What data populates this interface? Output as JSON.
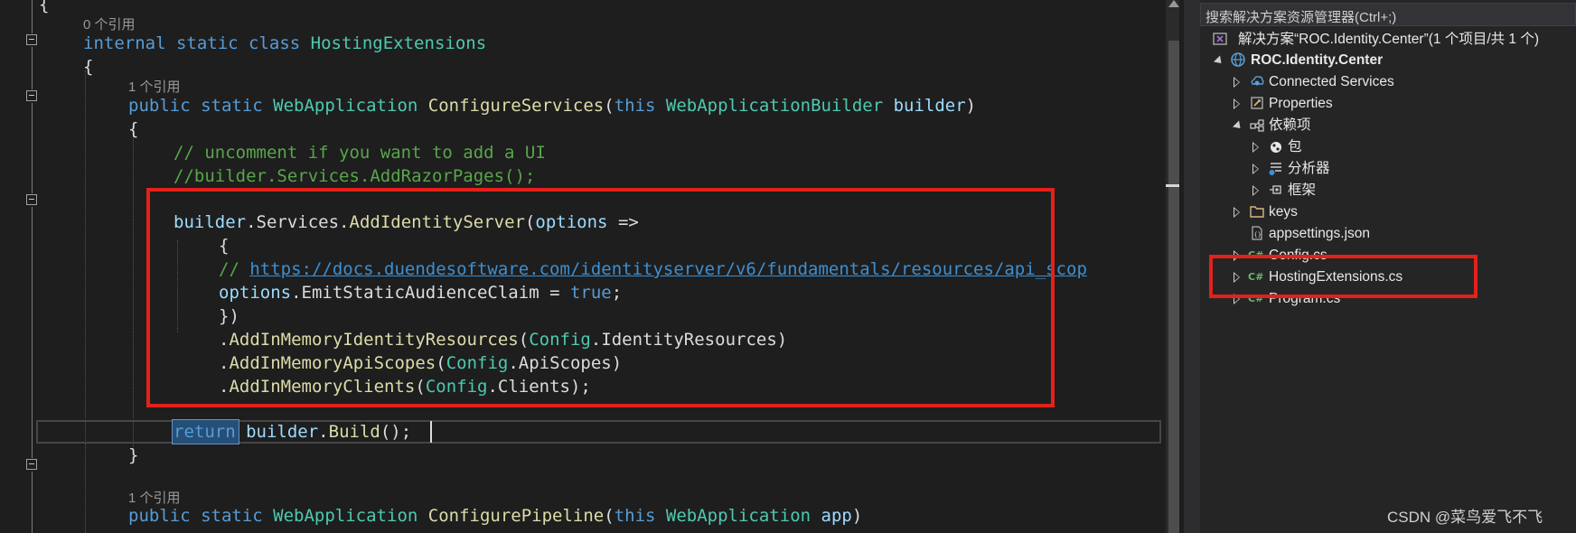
{
  "editor": {
    "codelens": {
      "class_refs": "0 个引用",
      "configure_services_refs": "1 个引用",
      "configure_pipeline_refs": "1 个引用"
    },
    "lines": {
      "open_brace_top": "{",
      "class_modifiers": "internal static class",
      "class_name": "HostingExtensions",
      "class_open": "{",
      "method_modifiers": "public static",
      "method_return_type": "WebApplication",
      "method_name": "ConfigureServices",
      "method_paren_open": "(",
      "this_kw": "this",
      "param_type": "WebApplicationBuilder",
      "param_name": "builder",
      "method_paren_close": ")",
      "method_open": "{",
      "comment_1": "// uncomment if you want to add a UI",
      "comment_2": "//builder.Services.AddRazorPages();",
      "add_is_var": "builder",
      "add_is_dot1": ".",
      "add_is_services": "Services",
      "add_is_dot2": ".",
      "add_is_method": "AddIdentityServer",
      "add_is_paren": "(",
      "add_is_options": "options",
      "add_is_arrow": " =>",
      "lambda_open": "{",
      "url_comment_prefix": "// ",
      "url": "https://docs.duendesoftware.com/identityserver/v6/fundamentals/resources/api_scop",
      "emit_options": "options",
      "emit_dot": ".",
      "emit_prop": "EmitStaticAudienceClaim",
      "emit_eq": " = ",
      "emit_true": "true",
      "emit_semi": ";",
      "lambda_close": "})",
      "identity_dot": ".",
      "identity_method": "AddInMemoryIdentityResources",
      "identity_paren": "(",
      "identity_config": "Config",
      "identity_dot2": ".",
      "identity_prop": "IdentityResources",
      "identity_close": ")",
      "api_dot": ".",
      "api_method": "AddInMemoryApiScopes",
      "api_paren": "(",
      "api_config": "Config",
      "api_dot2": ".",
      "api_prop": "ApiScopes",
      "api_close": ")",
      "clients_dot": ".",
      "clients_method": "AddInMemoryClients",
      "clients_paren": "(",
      "clients_config": "Config",
      "clients_dot2": ".",
      "clients_prop": "Clients",
      "clients_close": ");",
      "return_kw": "return",
      "return_var": "builder",
      "return_dot": ".",
      "return_method": "Build",
      "return_tail": "();",
      "method_close": "}",
      "pipeline_modifiers": "public static",
      "pipeline_return_type": "WebApplication",
      "pipeline_name": "ConfigurePipeline",
      "pipeline_paren_open": "(",
      "pipeline_this": "this",
      "pipeline_param_type": "WebApplication",
      "pipeline_param_name": "app",
      "pipeline_paren_close": ")"
    }
  },
  "solution_explorer": {
    "search_placeholder": "搜索解决方案资源管理器(Ctrl+;)",
    "solution_label": "解决方案“ROC.Identity.Center”(1 个项目/共 1 个)",
    "project_label": "ROC.Identity.Center",
    "items": [
      {
        "label": "Connected Services",
        "icon": "connected-services-icon"
      },
      {
        "label": "Properties",
        "icon": "wrench-icon"
      },
      {
        "label": "依赖项",
        "icon": "dependencies-icon"
      },
      {
        "label": "包",
        "icon": "package-icon"
      },
      {
        "label": "分析器",
        "icon": "analyzer-icon"
      },
      {
        "label": "框架",
        "icon": "framework-icon"
      },
      {
        "label": "keys",
        "icon": "folder-icon"
      },
      {
        "label": "appsettings.json",
        "icon": "json-file-icon"
      },
      {
        "label": "Config.cs",
        "icon": "csharp-file-icon"
      },
      {
        "label": "HostingExtensions.cs",
        "icon": "csharp-file-icon"
      },
      {
        "label": "Program.cs",
        "icon": "csharp-file-icon"
      }
    ]
  },
  "watermark": "CSDN @菜鸟爱飞不飞",
  "colors": {
    "annotation": "#e32119",
    "keyword": "#569cd6",
    "type": "#4ec9b0",
    "method": "#dcdcaa",
    "parameter": "#9cdcfe",
    "comment": "#57a64a"
  }
}
